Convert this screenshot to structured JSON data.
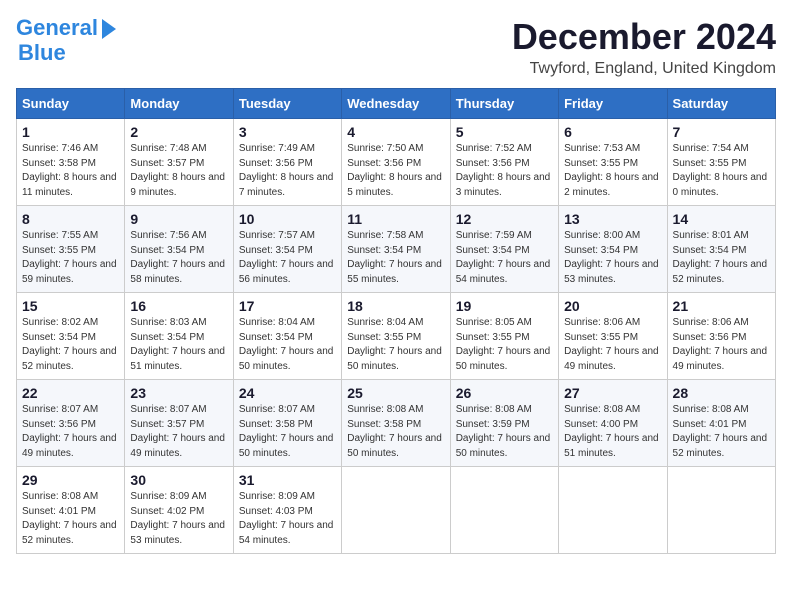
{
  "header": {
    "logo_line1": "General",
    "logo_line2": "Blue",
    "month": "December 2024",
    "location": "Twyford, England, United Kingdom"
  },
  "weekdays": [
    "Sunday",
    "Monday",
    "Tuesday",
    "Wednesday",
    "Thursday",
    "Friday",
    "Saturday"
  ],
  "weeks": [
    [
      {
        "day": "1",
        "sunrise": "7:46 AM",
        "sunset": "3:58 PM",
        "daylight": "8 hours and 11 minutes."
      },
      {
        "day": "2",
        "sunrise": "7:48 AM",
        "sunset": "3:57 PM",
        "daylight": "8 hours and 9 minutes."
      },
      {
        "day": "3",
        "sunrise": "7:49 AM",
        "sunset": "3:56 PM",
        "daylight": "8 hours and 7 minutes."
      },
      {
        "day": "4",
        "sunrise": "7:50 AM",
        "sunset": "3:56 PM",
        "daylight": "8 hours and 5 minutes."
      },
      {
        "day": "5",
        "sunrise": "7:52 AM",
        "sunset": "3:56 PM",
        "daylight": "8 hours and 3 minutes."
      },
      {
        "day": "6",
        "sunrise": "7:53 AM",
        "sunset": "3:55 PM",
        "daylight": "8 hours and 2 minutes."
      },
      {
        "day": "7",
        "sunrise": "7:54 AM",
        "sunset": "3:55 PM",
        "daylight": "8 hours and 0 minutes."
      }
    ],
    [
      {
        "day": "8",
        "sunrise": "7:55 AM",
        "sunset": "3:55 PM",
        "daylight": "7 hours and 59 minutes."
      },
      {
        "day": "9",
        "sunrise": "7:56 AM",
        "sunset": "3:54 PM",
        "daylight": "7 hours and 58 minutes."
      },
      {
        "day": "10",
        "sunrise": "7:57 AM",
        "sunset": "3:54 PM",
        "daylight": "7 hours and 56 minutes."
      },
      {
        "day": "11",
        "sunrise": "7:58 AM",
        "sunset": "3:54 PM",
        "daylight": "7 hours and 55 minutes."
      },
      {
        "day": "12",
        "sunrise": "7:59 AM",
        "sunset": "3:54 PM",
        "daylight": "7 hours and 54 minutes."
      },
      {
        "day": "13",
        "sunrise": "8:00 AM",
        "sunset": "3:54 PM",
        "daylight": "7 hours and 53 minutes."
      },
      {
        "day": "14",
        "sunrise": "8:01 AM",
        "sunset": "3:54 PM",
        "daylight": "7 hours and 52 minutes."
      }
    ],
    [
      {
        "day": "15",
        "sunrise": "8:02 AM",
        "sunset": "3:54 PM",
        "daylight": "7 hours and 52 minutes."
      },
      {
        "day": "16",
        "sunrise": "8:03 AM",
        "sunset": "3:54 PM",
        "daylight": "7 hours and 51 minutes."
      },
      {
        "day": "17",
        "sunrise": "8:04 AM",
        "sunset": "3:54 PM",
        "daylight": "7 hours and 50 minutes."
      },
      {
        "day": "18",
        "sunrise": "8:04 AM",
        "sunset": "3:55 PM",
        "daylight": "7 hours and 50 minutes."
      },
      {
        "day": "19",
        "sunrise": "8:05 AM",
        "sunset": "3:55 PM",
        "daylight": "7 hours and 50 minutes."
      },
      {
        "day": "20",
        "sunrise": "8:06 AM",
        "sunset": "3:55 PM",
        "daylight": "7 hours and 49 minutes."
      },
      {
        "day": "21",
        "sunrise": "8:06 AM",
        "sunset": "3:56 PM",
        "daylight": "7 hours and 49 minutes."
      }
    ],
    [
      {
        "day": "22",
        "sunrise": "8:07 AM",
        "sunset": "3:56 PM",
        "daylight": "7 hours and 49 minutes."
      },
      {
        "day": "23",
        "sunrise": "8:07 AM",
        "sunset": "3:57 PM",
        "daylight": "7 hours and 49 minutes."
      },
      {
        "day": "24",
        "sunrise": "8:07 AM",
        "sunset": "3:58 PM",
        "daylight": "7 hours and 50 minutes."
      },
      {
        "day": "25",
        "sunrise": "8:08 AM",
        "sunset": "3:58 PM",
        "daylight": "7 hours and 50 minutes."
      },
      {
        "day": "26",
        "sunrise": "8:08 AM",
        "sunset": "3:59 PM",
        "daylight": "7 hours and 50 minutes."
      },
      {
        "day": "27",
        "sunrise": "8:08 AM",
        "sunset": "4:00 PM",
        "daylight": "7 hours and 51 minutes."
      },
      {
        "day": "28",
        "sunrise": "8:08 AM",
        "sunset": "4:01 PM",
        "daylight": "7 hours and 52 minutes."
      }
    ],
    [
      {
        "day": "29",
        "sunrise": "8:08 AM",
        "sunset": "4:01 PM",
        "daylight": "7 hours and 52 minutes."
      },
      {
        "day": "30",
        "sunrise": "8:09 AM",
        "sunset": "4:02 PM",
        "daylight": "7 hours and 53 minutes."
      },
      {
        "day": "31",
        "sunrise": "8:09 AM",
        "sunset": "4:03 PM",
        "daylight": "7 hours and 54 minutes."
      },
      null,
      null,
      null,
      null
    ]
  ]
}
